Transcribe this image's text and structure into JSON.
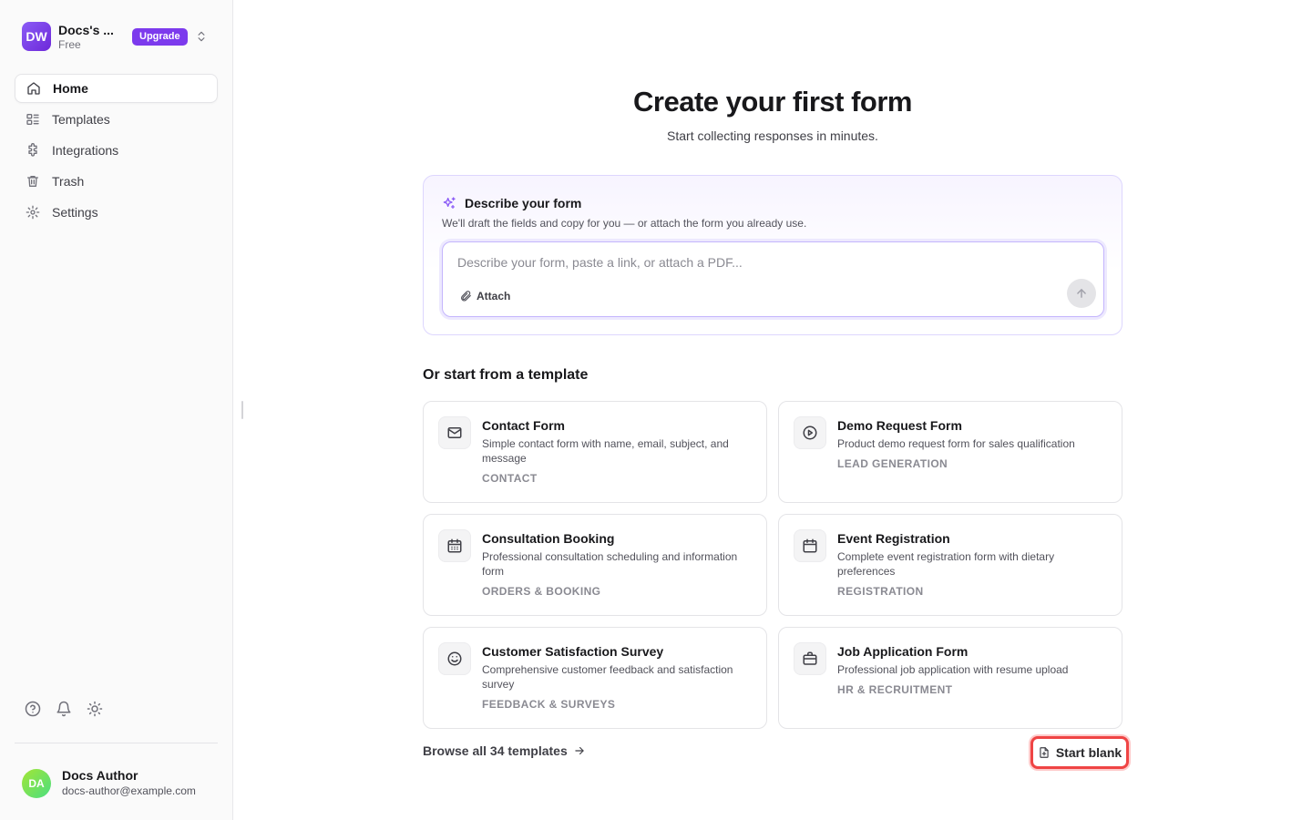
{
  "workspace": {
    "initials": "DW",
    "name": "Docs's ...",
    "plan": "Free",
    "upgrade_label": "Upgrade"
  },
  "nav": {
    "items": [
      {
        "label": "Home",
        "icon": "home-icon",
        "active": true
      },
      {
        "label": "Templates",
        "icon": "templates-icon"
      },
      {
        "label": "Integrations",
        "icon": "puzzle-icon"
      },
      {
        "label": "Trash",
        "icon": "trash-icon"
      },
      {
        "label": "Settings",
        "icon": "gear-icon"
      }
    ]
  },
  "footer_icons": [
    "help-icon",
    "bell-icon",
    "sun-icon"
  ],
  "user": {
    "initials": "DA",
    "name": "Docs Author",
    "email": "docs-author@example.com"
  },
  "main": {
    "title": "Create your first form",
    "subtitle": "Start collecting responses in minutes."
  },
  "describe": {
    "title": "Describe your form",
    "subtitle": "We'll draft the fields and copy for you — or attach the form you already use.",
    "placeholder": "Describe your form, paste a link, or attach a PDF...",
    "value": "",
    "attach_label": "Attach"
  },
  "templates": {
    "section_title": "Or start from a template",
    "items": [
      {
        "title": "Contact Form",
        "description": "Simple contact form with name, email, subject, and message",
        "category": "CONTACT",
        "icon": "mail-icon"
      },
      {
        "title": "Demo Request Form",
        "description": "Product demo request form for sales qualification",
        "category": "LEAD GENERATION",
        "icon": "play-circle-icon"
      },
      {
        "title": "Consultation Booking",
        "description": "Professional consultation scheduling and information form",
        "category": "ORDERS & BOOKING",
        "icon": "calendar-days-icon"
      },
      {
        "title": "Event Registration",
        "description": "Complete event registration form with dietary preferences",
        "category": "REGISTRATION",
        "icon": "calendar-icon"
      },
      {
        "title": "Customer Satisfaction Survey",
        "description": "Comprehensive customer feedback and satisfaction survey",
        "category": "FEEDBACK & SURVEYS",
        "icon": "smile-icon"
      },
      {
        "title": "Job Application Form",
        "description": "Professional job application with resume upload",
        "category": "HR & RECRUITMENT",
        "icon": "briefcase-icon"
      }
    ],
    "browse_label": "Browse all 34 templates",
    "start_blank_label": "Start blank"
  },
  "colors": {
    "accent": "#7c3aed",
    "highlight": "#ef4444"
  }
}
